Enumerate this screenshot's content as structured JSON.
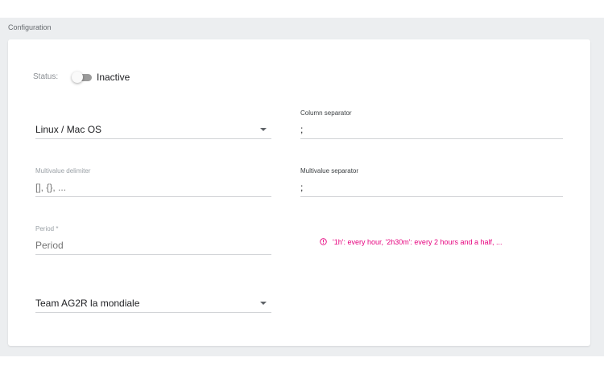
{
  "section": {
    "title": "Configuration"
  },
  "status": {
    "label": "Status:",
    "value": "Inactive",
    "enabled": false
  },
  "fields": {
    "os": {
      "value": "Linux / Mac OS"
    },
    "column_separator": {
      "label": "Column separator",
      "value": ";"
    },
    "multivalue_delimiter": {
      "label": "Multivalue delimiter",
      "placeholder": "[], {}, ..."
    },
    "multivalue_separator": {
      "label": "Multivalue separator",
      "value": ";"
    },
    "period": {
      "label": "Period *",
      "placeholder": "Period"
    },
    "team": {
      "value": "Team AG2R la mondiale"
    }
  },
  "period_hint": {
    "icon": "info-circle-icon",
    "text": "'1h': every hour, '2h30m': every 2 hours and a half, ..."
  },
  "colors": {
    "accent": "#e6007e",
    "panel_background": "#eceef0",
    "toggle_off": "#9b9b9b"
  }
}
